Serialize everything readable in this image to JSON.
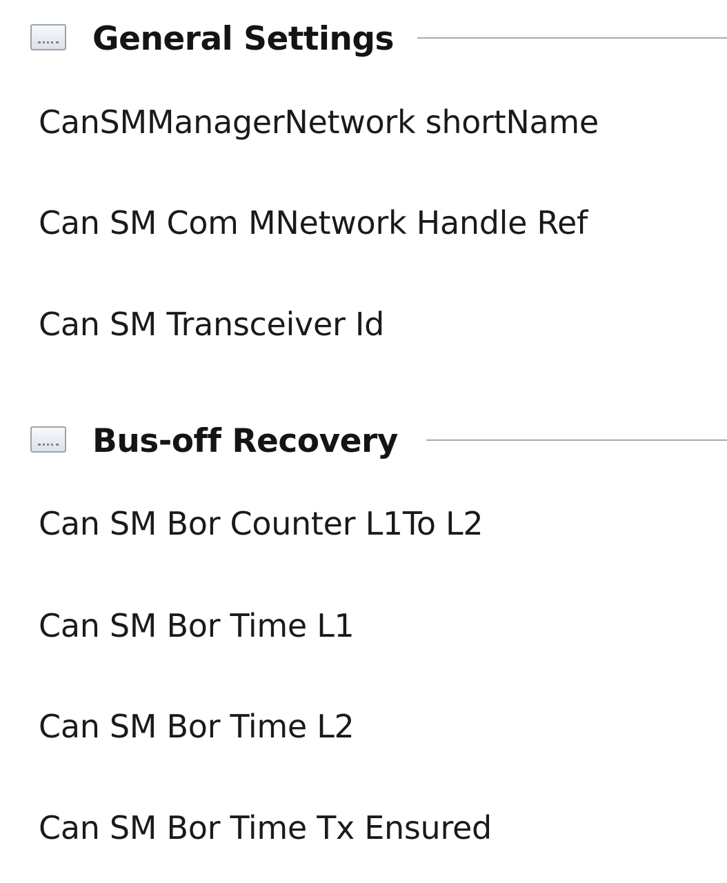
{
  "sections": [
    {
      "title": "General Settings",
      "icon": "collapse-icon",
      "fields": [
        "CanSMManagerNetwork shortName",
        "Can SM Com MNetwork Handle Ref",
        "Can SM Transceiver Id"
      ]
    },
    {
      "title": "Bus-off Recovery",
      "icon": "collapse-icon",
      "fields": [
        "Can SM Bor Counter L1To L2",
        "Can SM Bor Time L1",
        "Can SM Bor Time L2",
        "Can SM Bor Time Tx Ensured"
      ]
    }
  ]
}
